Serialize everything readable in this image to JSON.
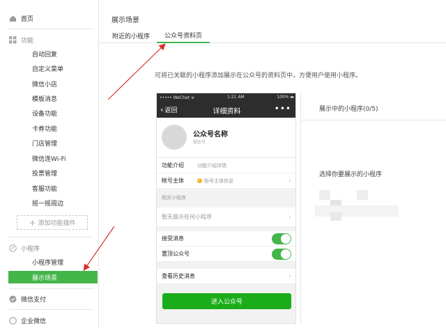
{
  "sidebar": {
    "home": "首页",
    "features_heading": "功能",
    "feature_items": [
      "自动回复",
      "自定义菜单",
      "微信小店",
      "模板消息",
      "设备功能",
      "卡券功能",
      "门店管理",
      "微信连Wi-Fi",
      "投票管理",
      "客服功能",
      "摇一摇周边"
    ],
    "add_plugin": "添加功能插件",
    "miniprogram_heading": "小程序",
    "miniprogram_items": [
      "小程序管理",
      "展示场景"
    ],
    "wechat_pay": "微信支付",
    "enterprise_wechat": "企业微信"
  },
  "header": {
    "title": "展示场景",
    "tabs": [
      "附近的小程序",
      "公众号资料页"
    ],
    "active_tab": "公众号资料页"
  },
  "description": "可将已关联的小程序添加展示在公众号的资料页中，方便用户使用小程序。",
  "phone": {
    "carrier": "••••• WeChat ᯤ",
    "time": "1:21 AM",
    "battery": "100% ▬",
    "back": "返回",
    "nav_title": "详细资料",
    "more": "•••",
    "account_name": "公众号名称",
    "account_id": "微信号",
    "rows": {
      "intro_label": "功能介绍",
      "intro_value": "功能介绍详情",
      "subject_label": "帐号主体",
      "subject_value": "账号主体信息"
    },
    "related_label": "相关小程序",
    "no_miniprogram": "暂无展示任何小程序",
    "receive_msgs": "接受消息",
    "pin_account": "置顶公众号",
    "history": "查看历史消息",
    "enter_button": "进入公众号"
  },
  "right_panel": {
    "showing": "展示中的小程序(0/5)",
    "choose": "选择你要展示的小程序"
  },
  "colors": {
    "accent": "#44b549",
    "button_green": "#1aad19",
    "nav_dark": "#2d2d2d",
    "annotation_red": "#d9302c"
  }
}
